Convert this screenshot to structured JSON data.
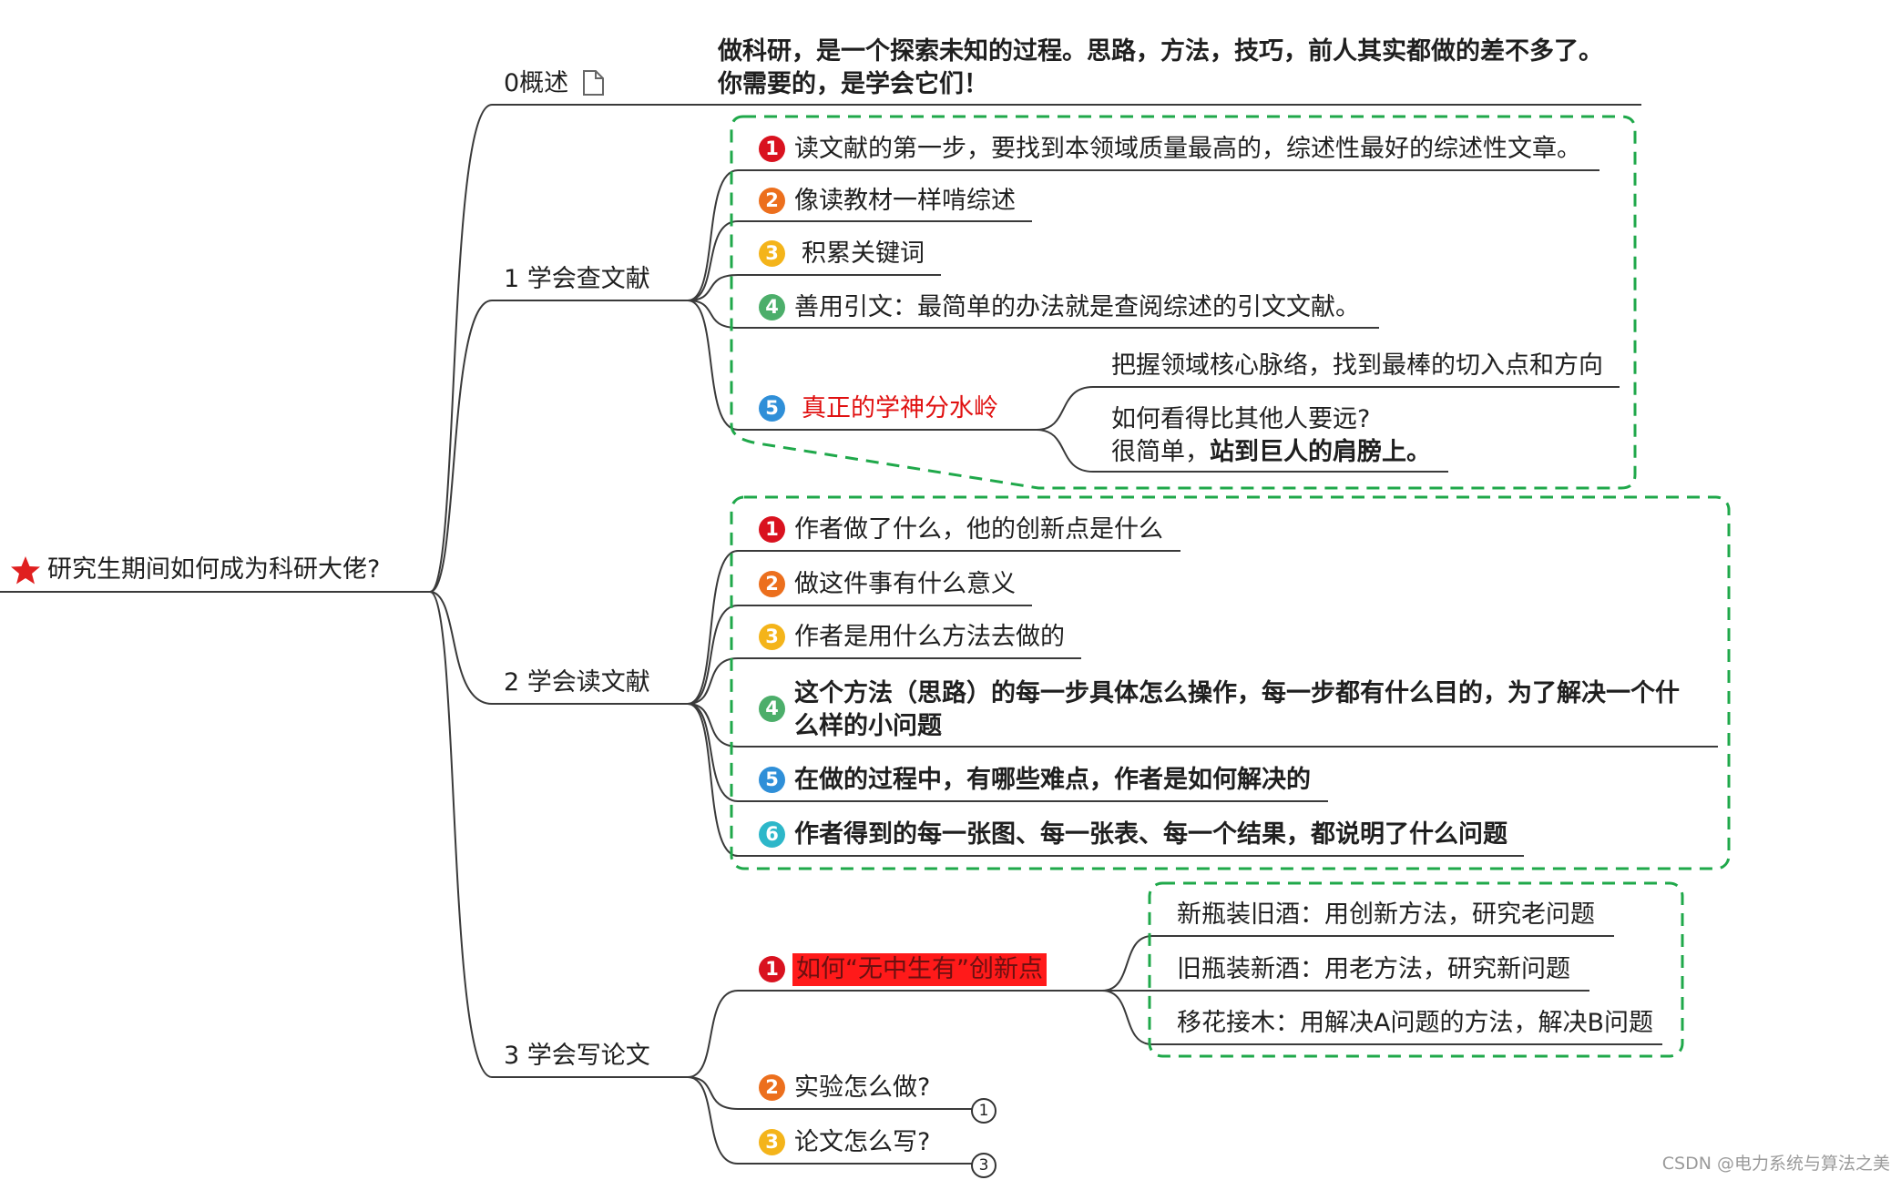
{
  "root": {
    "label": "研究生期间如何成为科研大佬?",
    "icon": "star-icon",
    "icon_color": "#e02020"
  },
  "overview": {
    "label": "0概述",
    "icon": "note-icon",
    "note_line1": "做科研，是一个探索未知的过程。思路，方法，技巧，前人其实都做的差不多了。",
    "note_line2": "你需要的，是学会它们！"
  },
  "branch1": {
    "label": "1 学会查文献",
    "items": [
      {
        "num": "1",
        "text": "读文献的第一步，要找到本领域质量最高的，综述性最好的综述性文章。"
      },
      {
        "num": "2",
        "text": "像读教材一样啃综述"
      },
      {
        "num": "3",
        "text": "积累关键词"
      },
      {
        "num": "4",
        "text": "善用引文：最简单的办法就是查阅综述的引文文献。"
      },
      {
        "num": "5",
        "text": "真正的学神分水岭"
      }
    ],
    "sub5": {
      "a": "把握领域核心脉络，找到最棒的切入点和方向",
      "b_line1": "如何看得比其他人要远?",
      "b_line2_normal": "很简单，",
      "b_line2_bold": "站到巨人的肩膀上。"
    }
  },
  "branch2": {
    "label": "2 学会读文献",
    "items": [
      {
        "num": "1",
        "text": "作者做了什么，他的创新点是什么"
      },
      {
        "num": "2",
        "text": "做这件事有什么意义"
      },
      {
        "num": "3",
        "text": "作者是用什么方法去做的"
      },
      {
        "num": "4",
        "line1": "这个方法（思路）的每一步具体怎么操作，每一步都有什么目的，为了解决一个什",
        "line2": "么样的小问题"
      },
      {
        "num": "5",
        "text": "在做的过程中，有哪些难点，作者是如何解决的"
      },
      {
        "num": "6",
        "text": "作者得到的每一张图、每一张表、每一个结果，都说明了什么问题"
      }
    ]
  },
  "branch3": {
    "label": "3 学会写论文",
    "items": [
      {
        "num": "1",
        "text": "如何“无中生有”创新点"
      },
      {
        "num": "2",
        "text": "实验怎么做?",
        "collapsed": "1"
      },
      {
        "num": "3",
        "text": "论文怎么写?",
        "collapsed": "3"
      }
    ],
    "sub1": [
      "新瓶装旧酒：用创新方法，研究老问题",
      "旧瓶装新酒：用老方法，研究新问题",
      "移花接木：用解决A问题的方法，解决B问题"
    ]
  },
  "watermark": "CSDN @电力系统与算法之美",
  "colors": {
    "line": "#3a3a3a",
    "dashed_box": "#1fa84a",
    "highlight": "#ff1a1a",
    "badge_red": "#d9121f",
    "badge_orange": "#ec6f1d",
    "badge_yellow": "#f4b41a",
    "badge_green": "#4cae6a",
    "badge_blue": "#2f8fd8",
    "badge_cyan": "#2db7c9",
    "red_text": "#e01010"
  }
}
